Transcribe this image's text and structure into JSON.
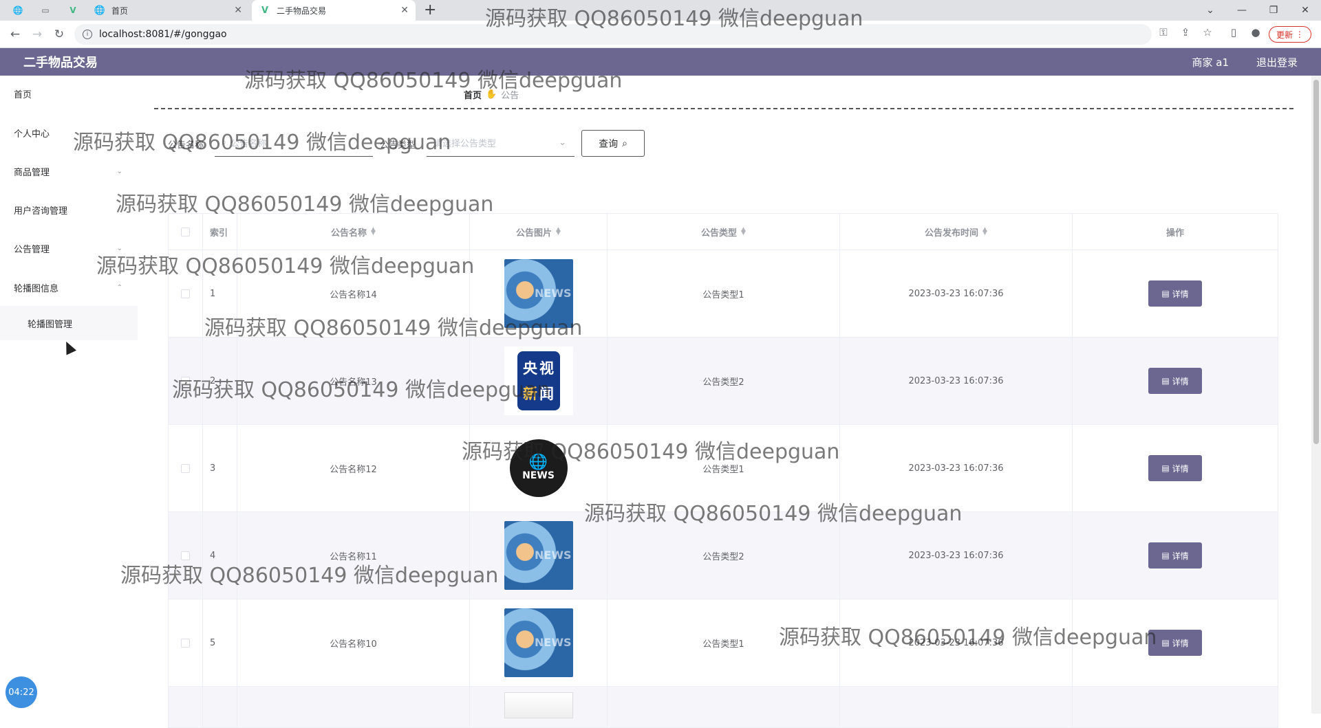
{
  "browser": {
    "tabs": [
      {
        "title": "首页",
        "icon": "globe-icon"
      },
      {
        "title": "二手物品交易",
        "icon": "vue-icon"
      }
    ],
    "new_tab": "+",
    "url": "localhost:8081/#/gonggao",
    "update_label": "更新"
  },
  "header": {
    "title": "二手物品交易",
    "user": "商家 a1",
    "logout": "退出登录"
  },
  "sidebar": {
    "items": [
      {
        "label": "首页"
      },
      {
        "label": "个人中心"
      },
      {
        "label": "商品管理",
        "arrow": "⌄"
      },
      {
        "label": "用户咨询管理"
      },
      {
        "label": "公告管理",
        "arrow": "⌄"
      },
      {
        "label": "轮播图信息",
        "arrow": "⌃"
      }
    ],
    "sub_item": "轮播图管理"
  },
  "breadcrumb": {
    "home": "首页",
    "sep_icon": "hand-icon",
    "current": "公告"
  },
  "search": {
    "name_label": "公告名称",
    "name_placeholder": "公告名称",
    "type_label": "公告类型",
    "type_placeholder": "请选择公告类型",
    "button": "查询"
  },
  "table": {
    "headers": [
      "索引",
      "公告名称",
      "公告图片",
      "公告类型",
      "公告发布时间",
      "操作"
    ],
    "rows": [
      {
        "index": "1",
        "name": "公告名称14",
        "image": "news-blue",
        "type": "公告类型1",
        "time": "2023-03-23 16:07:36",
        "action": "详情"
      },
      {
        "index": "2",
        "name": "公告名称13",
        "image": "cctv-news",
        "type": "公告类型2",
        "time": "2023-03-23 16:07:36",
        "action": "详情"
      },
      {
        "index": "3",
        "name": "公告名称12",
        "image": "news-globe",
        "type": "公告类型1",
        "time": "2023-03-23 16:07:36",
        "action": "详情"
      },
      {
        "index": "4",
        "name": "公告名称11",
        "image": "news-blue",
        "type": "公告类型2",
        "time": "2023-03-23 16:07:36",
        "action": "详情"
      },
      {
        "index": "5",
        "name": "公告名称10",
        "image": "news-blue",
        "type": "公告类型1",
        "time": "2023-03-23 16:07:36",
        "action": "详情"
      }
    ]
  },
  "clock": "04:22",
  "watermark": "源码获取 QQ86050149 微信deepguan",
  "colors": {
    "header": "#6b6790",
    "button": "#6b6790"
  }
}
